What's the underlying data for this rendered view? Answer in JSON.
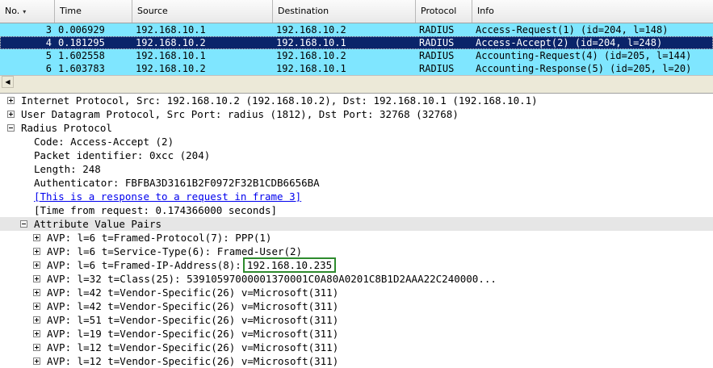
{
  "columns": {
    "no": "No.",
    "time": "Time",
    "source": "Source",
    "destination": "Destination",
    "protocol": "Protocol",
    "info": "Info"
  },
  "packets": [
    {
      "no": "3",
      "time": "0.006929",
      "source": "192.168.10.1",
      "destination": "192.168.10.2",
      "protocol": "RADIUS",
      "info": "Access-Request(1) (id=204, l=148)"
    },
    {
      "no": "4",
      "time": "0.181295",
      "source": "192.168.10.2",
      "destination": "192.168.10.1",
      "protocol": "RADIUS",
      "info": "Access-Accept(2) (id=204, l=248)"
    },
    {
      "no": "5",
      "time": "1.602558",
      "source": "192.168.10.1",
      "destination": "192.168.10.2",
      "protocol": "RADIUS",
      "info": "Accounting-Request(4) (id=205, l=144)"
    },
    {
      "no": "6",
      "time": "1.603783",
      "source": "192.168.10.2",
      "destination": "192.168.10.1",
      "protocol": "RADIUS",
      "info": "Accounting-Response(5) (id=205, l=20)"
    }
  ],
  "selected_index": 1,
  "details": {
    "ip": "Internet Protocol, Src: 192.168.10.2 (192.168.10.2), Dst: 192.168.10.1 (192.168.10.1)",
    "udp": "User Datagram Protocol, Src Port: radius (1812), Dst Port: 32768 (32768)",
    "radius": "Radius Protocol",
    "code": "Code: Access-Accept (2)",
    "packet_id": "Packet identifier: 0xcc (204)",
    "length": "Length: 248",
    "authenticator": "Authenticator: FBFBA3D3161B2F0972F32B1CDB6656BA",
    "response_link": "[This is a response to a request in frame 3]",
    "time_from_request": "[Time from request: 0.174366000 seconds]",
    "avp_header": "Attribute Value Pairs",
    "avps": [
      "AVP: l=6  t=Framed-Protocol(7): PPP(1)",
      "AVP: l=6  t=Service-Type(6): Framed-User(2)",
      "AVP: l=6  t=Framed-IP-Address(8):",
      "AVP: l=32  t=Class(25): 53910597000001370001C0A80A0201C8B1D2AAA22C240000...",
      "AVP: l=42  t=Vendor-Specific(26) v=Microsoft(311)",
      "AVP: l=42  t=Vendor-Specific(26) v=Microsoft(311)",
      "AVP: l=51  t=Vendor-Specific(26) v=Microsoft(311)",
      "AVP: l=19  t=Vendor-Specific(26) v=Microsoft(311)",
      "AVP: l=12  t=Vendor-Specific(26) v=Microsoft(311)",
      "AVP: l=12  t=Vendor-Specific(26) v=Microsoft(311)"
    ],
    "framed_ip_value": "192.168.10.235"
  },
  "colors": {
    "row_bg": "#7fe6ff",
    "selected_bg": "#0a246a",
    "highlight_border": "#2e8b2e"
  },
  "icons": {
    "sort": "chevron-down-icon",
    "scroll_left": "arrow-left-icon",
    "expand": "plus-box-icon",
    "collapse": "minus-box-icon"
  }
}
